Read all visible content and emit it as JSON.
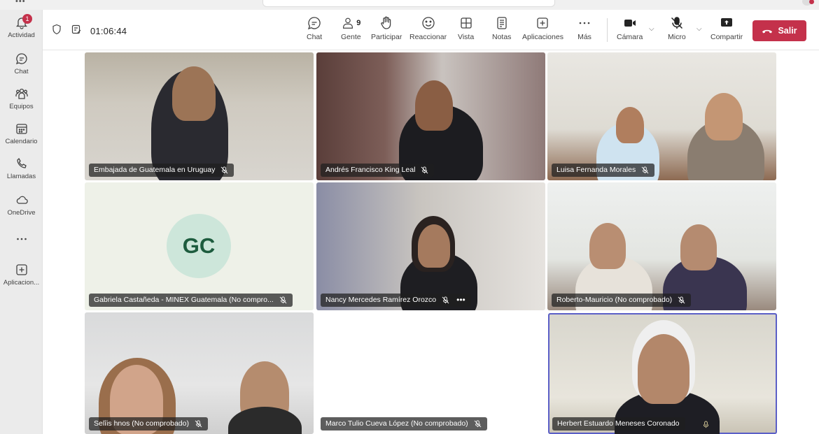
{
  "rail": {
    "items": [
      {
        "label": "Actividad",
        "icon": "bell-icon",
        "badge": "1"
      },
      {
        "label": "Chat",
        "icon": "chat-icon"
      },
      {
        "label": "Equipos",
        "icon": "teams-icon"
      },
      {
        "label": "Calendario",
        "icon": "calendar-icon"
      },
      {
        "label": "Llamadas",
        "icon": "phone-icon"
      },
      {
        "label": "OneDrive",
        "icon": "cloud-icon"
      },
      {
        "label": "",
        "icon": "more-apps-icon"
      },
      {
        "label": "Aplicacion...",
        "icon": "add-app-icon"
      }
    ]
  },
  "toolbar": {
    "timer": "01:06:44",
    "buttons": {
      "chat": "Chat",
      "people": "Gente",
      "people_count": "9",
      "raise": "Participar",
      "react": "Reaccionar",
      "view": "Vista",
      "notes": "Notas",
      "apps": "Aplicaciones",
      "more": "Más",
      "camera": "Cámara",
      "mic": "Micro",
      "share": "Compartir"
    },
    "leave": "Salir",
    "leave_color": "#c4314b"
  },
  "participants": [
    {
      "name": "Embajada de Guatemala en Uruguay",
      "muted": true
    },
    {
      "name": "Andrés Francisco King Leal",
      "muted": true
    },
    {
      "name": "Luisa Fernanda Morales",
      "muted": true
    },
    {
      "name": "Gabriela Castañeda - MINEX Guatemala (No compro...",
      "muted": true,
      "initials": "GC"
    },
    {
      "name": "Nancy Mercedes Ramírez Orozco",
      "muted": true
    },
    {
      "name": "Roberto-Mauricio (No comprobado)",
      "muted": true
    },
    {
      "name": "Selîis hnos (No comprobado)",
      "muted": true
    },
    {
      "name": "Marco Tulio Cueva López (No comprobado)",
      "muted": true
    },
    {
      "name": "Herbert Estuardo Meneses Coronado",
      "muted": false,
      "speaking": true
    }
  ],
  "accent_color": "#5b5fc7"
}
